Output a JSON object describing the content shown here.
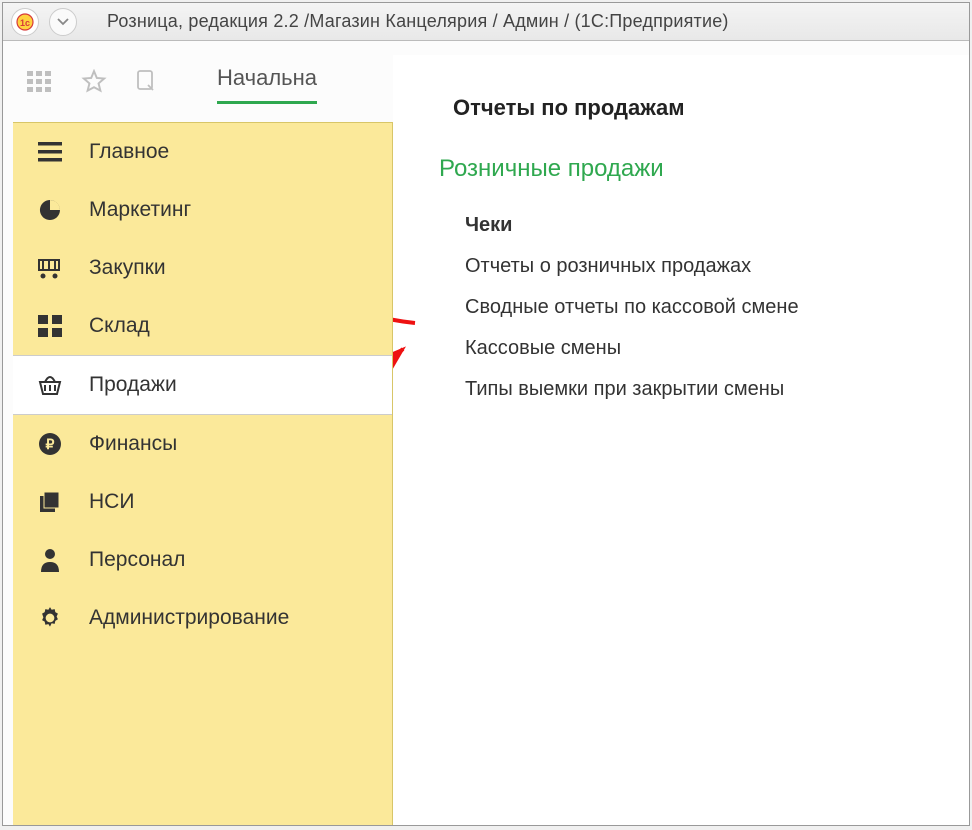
{
  "window": {
    "title": "Розница, редакция 2.2 /Магазин Канцелярия / Админ /  (1С:Предприятие)"
  },
  "start_tab": "Начальна",
  "sidebar": {
    "items": [
      {
        "label": "Главное",
        "icon": "menu"
      },
      {
        "label": "Маркетинг",
        "icon": "pie"
      },
      {
        "label": "Закупки",
        "icon": "cart"
      },
      {
        "label": "Склад",
        "icon": "tiles"
      },
      {
        "label": "Продажи",
        "icon": "basket",
        "selected": true
      },
      {
        "label": "Финансы",
        "icon": "ruble"
      },
      {
        "label": "НСИ",
        "icon": "folders"
      },
      {
        "label": "Персонал",
        "icon": "person"
      },
      {
        "label": "Администрирование",
        "icon": "gear"
      }
    ]
  },
  "content": {
    "header": "Отчеты по продажам",
    "section": "Розничные продажи",
    "items": [
      {
        "label": "Чеки",
        "bold": true
      },
      {
        "label": "Отчеты о розничных продажах"
      },
      {
        "label": "Сводные отчеты по кассовой смене"
      },
      {
        "label": "Кассовые смены"
      },
      {
        "label": "Типы выемки при закрытии смены"
      }
    ]
  }
}
